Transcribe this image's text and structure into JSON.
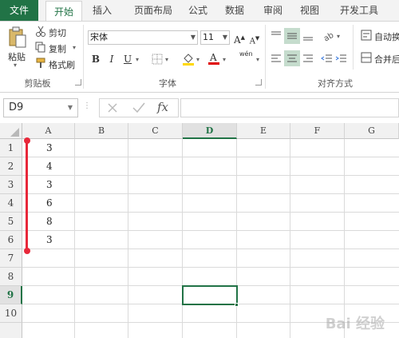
{
  "tabs": [
    "文件",
    "开始",
    "插入",
    "页面布局",
    "公式",
    "数据",
    "审阅",
    "视图",
    "开发工具"
  ],
  "clipboard": {
    "paste": "粘贴",
    "cut": "剪切",
    "copy": "复制",
    "format_painter": "格式刷",
    "group_label": "剪贴板"
  },
  "font": {
    "name": "宋体",
    "size": "11",
    "bold": "B",
    "italic": "I",
    "underline": "U",
    "grow": "A",
    "shrink": "A",
    "wen": "wén",
    "group_label": "字体"
  },
  "alignment": {
    "wrap_text": "自动换",
    "merge_center": "合并后",
    "group_label": "对齐方式"
  },
  "formula_bar": {
    "name_box": "D9",
    "fx": "fx",
    "value": ""
  },
  "columns": [
    "A",
    "B",
    "C",
    "D",
    "E",
    "F",
    "G"
  ],
  "rows": [
    "1",
    "2",
    "3",
    "4",
    "5",
    "6",
    "7",
    "8",
    "9",
    "10"
  ],
  "selected_cell": "D9",
  "cells_col_a": [
    "3",
    "4",
    "3",
    "6",
    "8",
    "3"
  ],
  "colors": {
    "accent": "#217346",
    "annotation": "#e8283a"
  },
  "watermark": "Bai 经验"
}
